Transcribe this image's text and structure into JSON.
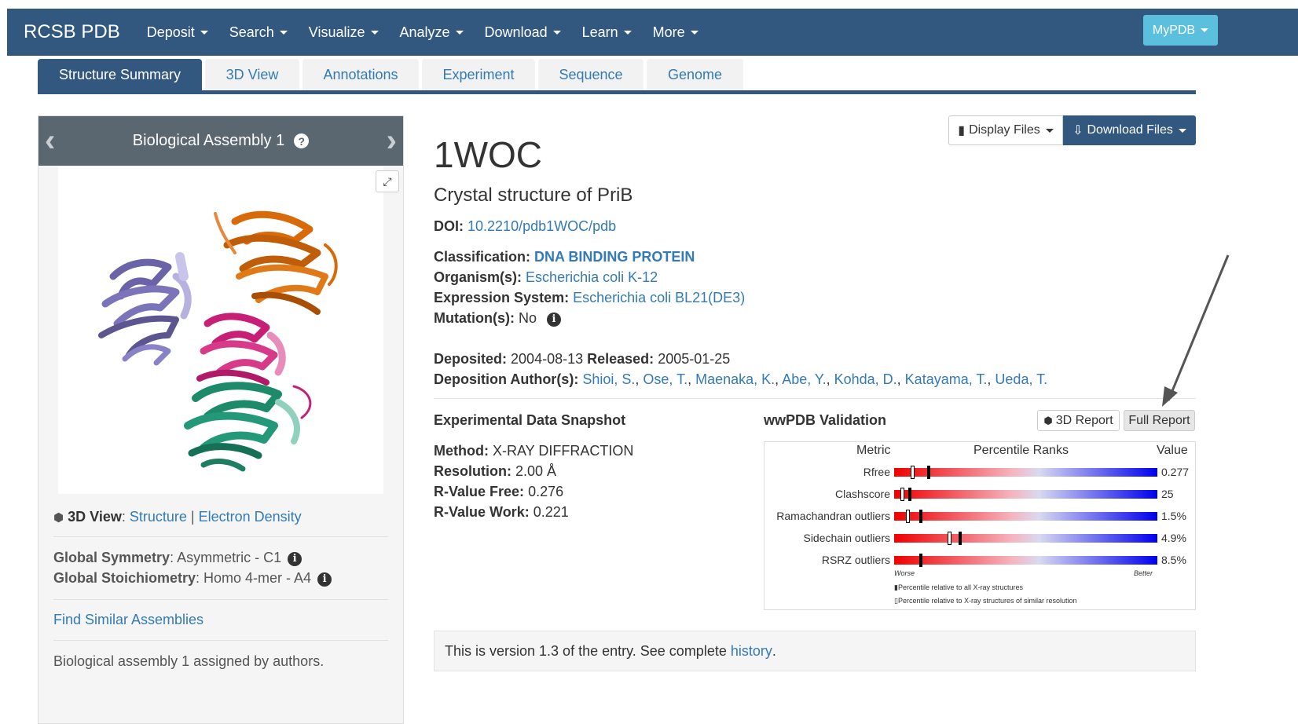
{
  "navbar": {
    "brand": "RCSB PDB",
    "items": [
      "Deposit",
      "Search",
      "Visualize",
      "Analyze",
      "Download",
      "Learn",
      "More"
    ],
    "mypdb": "MyPDB"
  },
  "tabs": [
    "Structure Summary",
    "3D View",
    "Annotations",
    "Experiment",
    "Sequence",
    "Genome"
  ],
  "assembly": {
    "title": "Biological Assembly 1",
    "view_label": "3D View",
    "view_structure": "Structure",
    "view_sep": "|",
    "view_density": "Electron Density",
    "symmetry_label": "Global Symmetry",
    "symmetry_value": ": Asymmetric - C1",
    "stoich_label": "Global Stoichiometry",
    "stoich_value": ": Homo 4-mer - A4",
    "similar_link": "Find Similar Assemblies",
    "assigned_note": "Biological assembly 1 assigned by authors."
  },
  "files": {
    "display": "Display Files",
    "download": "Download Files"
  },
  "entry": {
    "id": "1WOC",
    "title": "Crystal structure of PriB",
    "doi_label": "DOI:",
    "doi": "10.2210/pdb1WOC/pdb",
    "classification_label": "Classification:",
    "classification": "DNA BINDING PROTEIN",
    "organism_label": "Organism(s):",
    "organism": "Escherichia coli K-12",
    "expression_label": "Expression System:",
    "expression": "Escherichia coli BL21(DE3)",
    "mutation_label": "Mutation(s):",
    "mutation": "No",
    "deposited_label": "Deposited:",
    "deposited": "2004-08-13",
    "released_label": "Released:",
    "released": "2005-01-25",
    "authors_label": "Deposition Author(s):",
    "authors": [
      "Shioi, S.",
      "Ose, T.",
      "Maenaka, K.",
      "Abe, Y.",
      "Kohda, D.",
      "Katayama, T.",
      "Ueda, T."
    ]
  },
  "experimental": {
    "title": "Experimental Data Snapshot",
    "method_label": "Method:",
    "method": "X-RAY DIFFRACTION",
    "resolution_label": "Resolution:",
    "resolution": "2.00 Å",
    "rfree_label": "R-Value Free:",
    "rfree": "0.276",
    "rwork_label": "R-Value Work:",
    "rwork": "0.221"
  },
  "validation": {
    "title": "wwPDB Validation",
    "report_3d": "3D Report",
    "report_full": "Full Report",
    "col_metric": "Metric",
    "col_percentile": "Percentile Ranks",
    "col_value": "Value",
    "metrics": [
      {
        "name": "Rfree",
        "value": "0.277",
        "pct_all": 0.13,
        "pct_res": 0.07
      },
      {
        "name": "Clashscore",
        "value": "25",
        "pct_all": 0.06,
        "pct_res": 0.03
      },
      {
        "name": "Ramachandran outliers",
        "value": "1.5%",
        "pct_all": 0.1,
        "pct_res": 0.05
      },
      {
        "name": "Sidechain outliers",
        "value": "4.9%",
        "pct_all": 0.25,
        "pct_res": 0.21
      },
      {
        "name": "RSRZ outliers",
        "value": "8.5%",
        "pct_all": 0.1
      }
    ],
    "worse": "Worse",
    "better": "Better",
    "legend_all": "Percentile relative to all X-ray structures",
    "legend_res": "Percentile relative to X-ray structures of similar resolution"
  },
  "version": {
    "text": "This is version 1.3 of the entry. See complete",
    "link": "history",
    "end": "."
  },
  "colors": {
    "nav": "#325880",
    "link": "#337ab7",
    "mypdb": "#5bc0de"
  }
}
